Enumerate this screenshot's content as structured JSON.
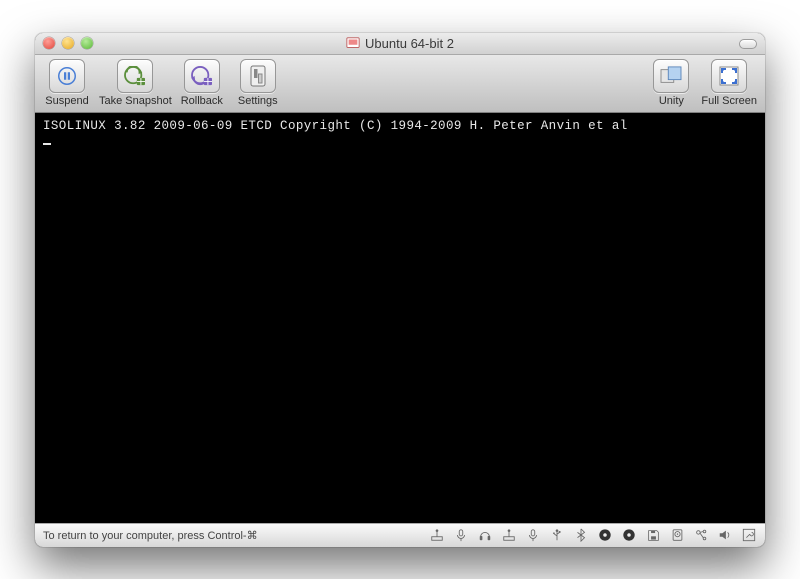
{
  "window": {
    "title": "Ubuntu 64-bit 2"
  },
  "toolbar": {
    "suspend": "Suspend",
    "take_snapshot": "Take Snapshot",
    "rollback": "Rollback",
    "settings": "Settings",
    "unity": "Unity",
    "fullscreen": "Full Screen"
  },
  "console": {
    "line1": "ISOLINUX 3.82 2009-06-09 ETCD Copyright (C) 1994-2009 H. Peter Anvin et al"
  },
  "statusbar": {
    "hint": "To return to your computer, press Control-⌘"
  }
}
